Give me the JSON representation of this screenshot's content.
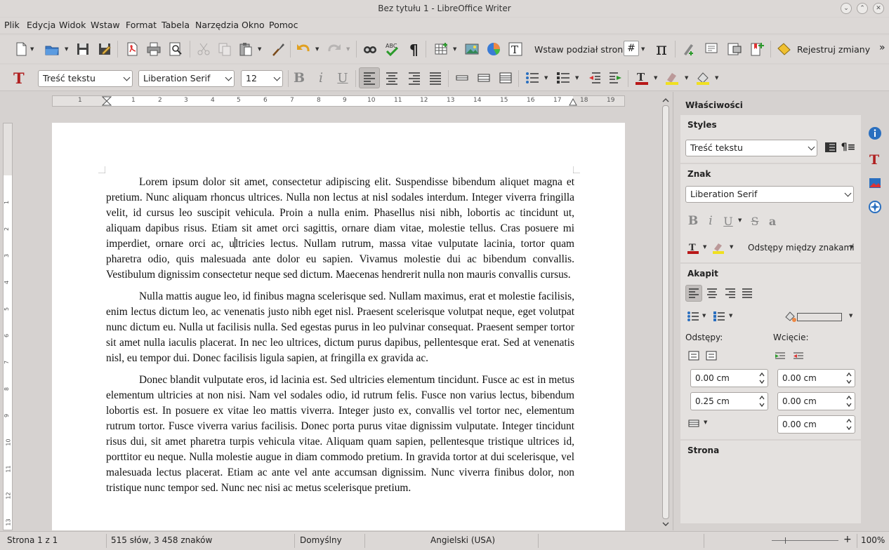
{
  "window": {
    "title": "Bez tytułu 1 - LibreOffice Writer"
  },
  "menu": [
    "Plik",
    "Edycja",
    "Widok",
    "Wstaw",
    "Format",
    "Tabela",
    "Narzędzia",
    "Okno",
    "Pomoc"
  ],
  "toolbar_standard": {
    "page_break_label": "Wstaw podział strony",
    "track_changes_label": "Rejestruj zmiany",
    "field_symbol": "#",
    "formula_symbol": "π",
    "overflow_symbol": "»"
  },
  "toolbar_formatting": {
    "paragraph_style": "Treść tekstu",
    "font_name": "Liberation Serif",
    "font_size": "12"
  },
  "ruler": {
    "labels": [
      "1",
      "1",
      "2",
      "3",
      "4",
      "5",
      "6",
      "7",
      "8",
      "9",
      "10",
      "11",
      "12",
      "13",
      "14",
      "15",
      "16",
      "17",
      "18",
      "19"
    ],
    "vertical_labels": [
      "1",
      "2",
      "3",
      "4",
      "5",
      "6",
      "7",
      "8",
      "9",
      "10",
      "11",
      "12",
      "13"
    ]
  },
  "document": {
    "paragraphs": [
      {
        "before_cursor": "Lorem ipsum dolor sit amet, consectetur adipiscing elit. Suspendisse bibendum aliquet magna et pretium. Nunc aliquam rhoncus ultrices. Nulla non lectus at nisl sodales interdum. Integer viverra fringilla velit, id cursus leo suscipit vehicula. Proin a nulla enim. Phasellus nisi nibh, lobortis ac tincidunt ut, aliquam dapibus risus. Etiam sit amet orci sagittis, ornare diam vitae, molestie tellus. Cras posuere mi imperdiet, ornare orci ac, u",
        "after_cursor": "ltricies lectus. Nullam rutrum, massa vitae vulputate lacinia, tortor quam pharetra odio, quis malesuada ante dolor eu sapien. Vivamus molestie dui ac bibendum convallis. Vestibulum dignissim consectetur neque sed dictum. Maecenas hendrerit nulla non mauris convallis cursus."
      },
      {
        "before_cursor": "Nulla mattis augue leo, id finibus magna scelerisque sed. Nullam maximus, erat et molestie facilisis, enim lectus dictum leo, ac venenatis justo nibh eget nisl. Praesent scelerisque volutpat neque, eget volutpat nunc dictum eu. Nulla ut facilisis nulla. Sed egestas purus in leo pulvinar consequat. Praesent semper tortor sit amet nulla iaculis placerat. In nec leo ultrices, dictum purus dapibus, pellentesque erat. Sed at venenatis nisl, eu tempor dui. Donec facilisis ligula sapien, at fringilla ex gravida ac.",
        "after_cursor": ""
      },
      {
        "before_cursor": "Donec blandit vulputate eros, id lacinia est. Sed ultricies elementum tincidunt. Fusce ac est in metus elementum ultricies at non nisi. Nam vel sodales odio, id rutrum felis. Fusce non varius lectus, bibendum lobortis est. In posuere ex vitae leo mattis viverra. Integer justo ex, convallis vel tortor nec, elementum rutrum tortor. Fusce viverra varius facilisis. Donec porta purus vitae dignissim vulputate. Integer tincidunt risus dui, sit amet pharetra turpis vehicula vitae. Aliquam quam sapien, pellentesque tristique ultrices id, porttitor eu neque. Nulla molestie augue in diam commodo pretium. In gravida tortor at dui scelerisque, vel malesuada lectus placerat. Etiam ac ante vel ante accumsan dignissim. Nunc viverra finibus dolor, non tristique nunc tempor sed. Nunc nec nisi ac metus scelerisque pretium.",
        "after_cursor": ""
      }
    ]
  },
  "sidebar": {
    "deck_title": "Właściwości",
    "styles": {
      "heading": "Styles",
      "style_value": "Treść tekstu"
    },
    "character": {
      "heading": "Znak",
      "font_value": "Liberation Serif",
      "spacing_label": "Odstępy między znakami"
    },
    "paragraph": {
      "heading": "Akapit",
      "spacing_label": "Odstępy:",
      "indent_label": "Wcięcie:",
      "above_spacing": "0.00 cm",
      "below_spacing": "0.25 cm",
      "before_indent": "0.00 cm",
      "after_indent": "0.00 cm",
      "first_line_indent": "0.00 cm"
    },
    "page": {
      "heading": "Strona"
    }
  },
  "statusbar": {
    "page": "Strona 1 z 1",
    "word_count": "515 słów, 3 458 znaków",
    "page_style": "Domyślny",
    "language": "Angielski (USA)",
    "zoom": "100%"
  },
  "colors": {
    "chrome": "#dcd8d6",
    "panel": "#e4e1df",
    "accent_blue": "#2a6fbf",
    "spell_underline": "#e03030"
  }
}
